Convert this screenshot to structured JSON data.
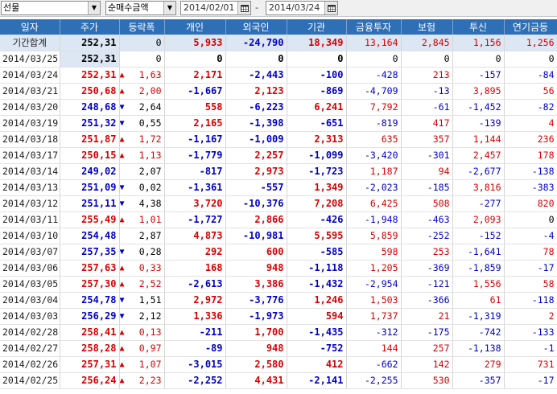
{
  "toolbar": {
    "market": "선물",
    "metric": "순매수금액",
    "date_from": "2014/02/01",
    "separator": "-",
    "date_to": "2014/03/24"
  },
  "columns": [
    "일자",
    "주가",
    "등락폭",
    "개인",
    "외국인",
    "기관",
    "금융투자",
    "보험",
    "투신",
    "연기금등"
  ],
  "colors": {
    "up": "#d80000",
    "down": "#0000c8",
    "header": "#2e6fb5"
  },
  "rows": [
    {
      "date": "기간합계",
      "price": "252,31",
      "dir": "none",
      "chg": "0",
      "indiv": "5,933",
      "foreign": "-24,790",
      "inst": "18,349",
      "fin": "13,164",
      "ins": "2,845",
      "trust": "1,156",
      "pension": "1,256"
    },
    {
      "date": "2014/03/25",
      "price": "252,31",
      "dir": "none",
      "chg": "0",
      "indiv": "0",
      "foreign": "0",
      "inst": "0",
      "fin": "0",
      "ins": "0",
      "trust": "0",
      "pension": "0"
    },
    {
      "date": "2014/03/24",
      "price": "252,31",
      "dir": "up",
      "chg": "1,63",
      "indiv": "2,171",
      "foreign": "-2,443",
      "inst": "-100",
      "fin": "-428",
      "ins": "213",
      "trust": "-157",
      "pension": "-84"
    },
    {
      "date": "2014/03/21",
      "price": "250,68",
      "dir": "up",
      "chg": "2,00",
      "indiv": "-1,667",
      "foreign": "2,123",
      "inst": "-869",
      "fin": "-4,709",
      "ins": "-13",
      "trust": "3,895",
      "pension": "56"
    },
    {
      "date": "2014/03/20",
      "price": "248,68",
      "dir": "dn",
      "chg": "2,64",
      "indiv": "558",
      "foreign": "-6,223",
      "inst": "6,241",
      "fin": "7,792",
      "ins": "-61",
      "trust": "-1,452",
      "pension": "-82"
    },
    {
      "date": "2014/03/19",
      "price": "251,32",
      "dir": "dn",
      "chg": "0,55",
      "indiv": "2,165",
      "foreign": "-1,398",
      "inst": "-651",
      "fin": "-819",
      "ins": "417",
      "trust": "-139",
      "pension": "4"
    },
    {
      "date": "2014/03/18",
      "price": "251,87",
      "dir": "up",
      "chg": "1,72",
      "indiv": "-1,167",
      "foreign": "-1,009",
      "inst": "2,313",
      "fin": "635",
      "ins": "357",
      "trust": "1,144",
      "pension": "236"
    },
    {
      "date": "2014/03/17",
      "price": "250,15",
      "dir": "up",
      "chg": "1,13",
      "indiv": "-1,779",
      "foreign": "2,257",
      "inst": "-1,099",
      "fin": "-3,420",
      "ins": "-301",
      "trust": "2,457",
      "pension": "178"
    },
    {
      "date": "2014/03/14",
      "price": "249,02",
      "dir": "none",
      "chg": "2,07",
      "indiv": "-817",
      "foreign": "2,973",
      "inst": "-1,723",
      "fin": "1,187",
      "ins": "94",
      "trust": "-2,677",
      "pension": "-138"
    },
    {
      "date": "2014/03/13",
      "price": "251,09",
      "dir": "dn",
      "chg": "0,02",
      "indiv": "-1,361",
      "foreign": "-557",
      "inst": "1,349",
      "fin": "-2,023",
      "ins": "-185",
      "trust": "3,816",
      "pension": "-383"
    },
    {
      "date": "2014/03/12",
      "price": "251,11",
      "dir": "dn",
      "chg": "4,38",
      "indiv": "3,720",
      "foreign": "-10,376",
      "inst": "7,208",
      "fin": "6,425",
      "ins": "508",
      "trust": "-277",
      "pension": "820"
    },
    {
      "date": "2014/03/11",
      "price": "255,49",
      "dir": "up",
      "chg": "1,01",
      "indiv": "-1,727",
      "foreign": "2,866",
      "inst": "-426",
      "fin": "-1,948",
      "ins": "-463",
      "trust": "2,093",
      "pension": "0"
    },
    {
      "date": "2014/03/10",
      "price": "254,48",
      "dir": "none",
      "chg": "2,87",
      "indiv": "4,873",
      "foreign": "-10,981",
      "inst": "5,595",
      "fin": "5,859",
      "ins": "-252",
      "trust": "-152",
      "pension": "-4"
    },
    {
      "date": "2014/03/07",
      "price": "257,35",
      "dir": "dn",
      "chg": "0,28",
      "indiv": "292",
      "foreign": "600",
      "inst": "-585",
      "fin": "598",
      "ins": "253",
      "trust": "-1,641",
      "pension": "78"
    },
    {
      "date": "2014/03/06",
      "price": "257,63",
      "dir": "up",
      "chg": "0,33",
      "indiv": "168",
      "foreign": "948",
      "inst": "-1,118",
      "fin": "1,205",
      "ins": "-369",
      "trust": "-1,859",
      "pension": "-17"
    },
    {
      "date": "2014/03/05",
      "price": "257,30",
      "dir": "up",
      "chg": "2,52",
      "indiv": "-2,613",
      "foreign": "3,386",
      "inst": "-1,432",
      "fin": "-2,954",
      "ins": "-121",
      "trust": "1,556",
      "pension": "58"
    },
    {
      "date": "2014/03/04",
      "price": "254,78",
      "dir": "dn",
      "chg": "1,51",
      "indiv": "2,972",
      "foreign": "-3,776",
      "inst": "1,246",
      "fin": "1,503",
      "ins": "-366",
      "trust": "61",
      "pension": "-118"
    },
    {
      "date": "2014/03/03",
      "price": "256,29",
      "dir": "dn",
      "chg": "2,12",
      "indiv": "1,336",
      "foreign": "-1,973",
      "inst": "594",
      "fin": "1,737",
      "ins": "21",
      "trust": "-1,319",
      "pension": "2"
    },
    {
      "date": "2014/02/28",
      "price": "258,41",
      "dir": "up",
      "chg": "0,13",
      "indiv": "-211",
      "foreign": "1,700",
      "inst": "-1,435",
      "fin": "-312",
      "ins": "-175",
      "trust": "-742",
      "pension": "-133"
    },
    {
      "date": "2014/02/27",
      "price": "258,28",
      "dir": "up",
      "chg": "0,97",
      "indiv": "-89",
      "foreign": "948",
      "inst": "-752",
      "fin": "144",
      "ins": "257",
      "trust": "-1,138",
      "pension": "-1"
    },
    {
      "date": "2014/02/26",
      "price": "257,31",
      "dir": "up",
      "chg": "1,07",
      "indiv": "-3,015",
      "foreign": "2,580",
      "inst": "412",
      "fin": "-662",
      "ins": "142",
      "trust": "279",
      "pension": "731"
    },
    {
      "date": "2014/02/25",
      "price": "256,24",
      "dir": "up",
      "chg": "2,23",
      "indiv": "-2,252",
      "foreign": "4,431",
      "inst": "-2,141",
      "fin": "-2,255",
      "ins": "530",
      "trust": "-357",
      "pension": "-17"
    }
  ]
}
